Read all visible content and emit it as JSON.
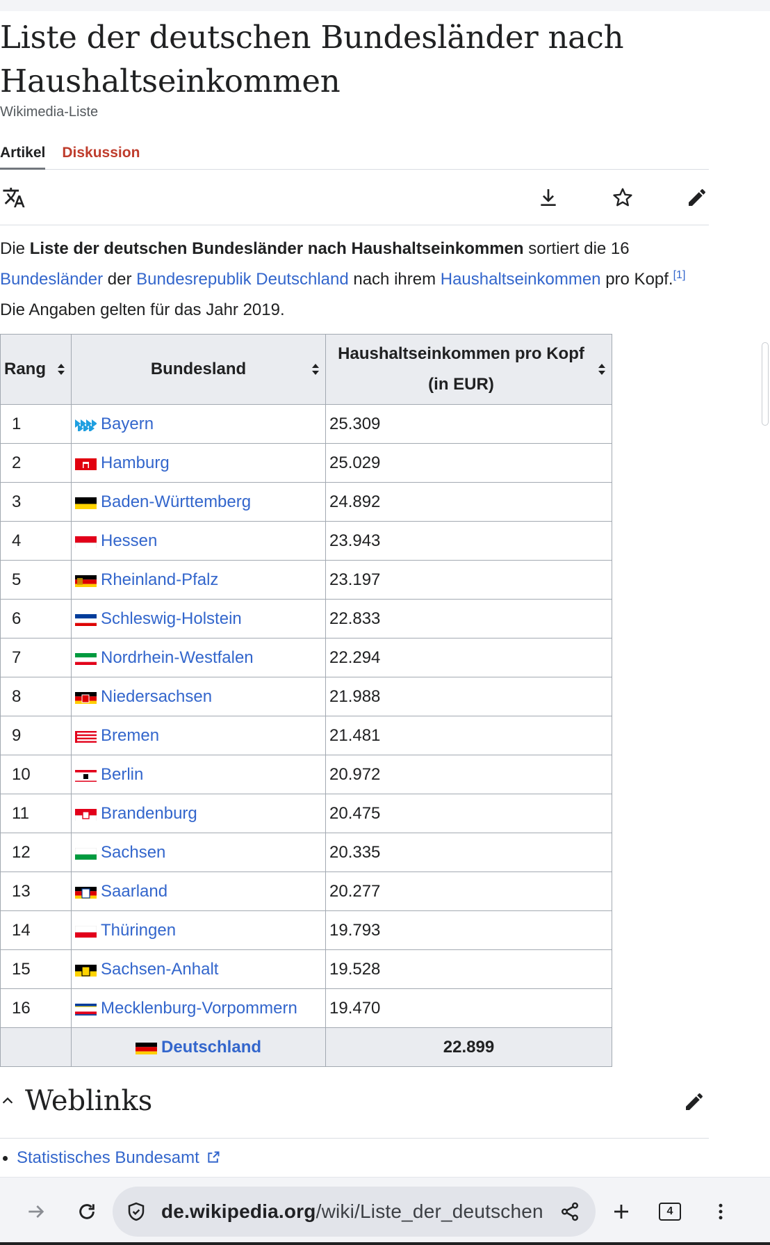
{
  "page": {
    "title": "Liste der deutschen Bundesländer nach Haushaltseinkommen",
    "subtitle": "Wikimedia-Liste"
  },
  "tabs": [
    {
      "label": "Artikel"
    },
    {
      "label": "Diskussion"
    }
  ],
  "toolbar": {
    "icons": [
      "translate-icon",
      "download-icon",
      "star-icon",
      "edit-pencil-icon"
    ]
  },
  "intro": {
    "t1": "Die ",
    "bold": "Liste der deutschen Bundesländer nach Haushaltseinkommen",
    "t2": " sortiert die 16 ",
    "link1": "Bundesländer",
    "t3": " der ",
    "link2": "Bundesrepublik Deutschland",
    "t4": " nach ihrem ",
    "link3": "Haushaltseinkommen",
    "t5": " pro Kopf.",
    "ref": "[1]",
    "t6": " Die Angaben gelten für das Jahr 2019."
  },
  "table": {
    "headers": {
      "rank": "Rang",
      "state": "Bundesland",
      "income_line1": "Haushaltseinkommen pro Kopf",
      "income_line2": "(in EUR)"
    },
    "rows": [
      {
        "rank": "1",
        "state": "Bayern",
        "value": "25.309"
      },
      {
        "rank": "2",
        "state": "Hamburg",
        "value": "25.029"
      },
      {
        "rank": "3",
        "state": "Baden-Württemberg",
        "value": "24.892"
      },
      {
        "rank": "4",
        "state": "Hessen",
        "value": "23.943"
      },
      {
        "rank": "5",
        "state": "Rheinland-Pfalz",
        "value": "23.197"
      },
      {
        "rank": "6",
        "state": "Schleswig-Holstein",
        "value": "22.833"
      },
      {
        "rank": "7",
        "state": "Nordrhein-Westfalen",
        "value": "22.294"
      },
      {
        "rank": "8",
        "state": "Niedersachsen",
        "value": "21.988"
      },
      {
        "rank": "9",
        "state": "Bremen",
        "value": "21.481"
      },
      {
        "rank": "10",
        "state": "Berlin",
        "value": "20.972"
      },
      {
        "rank": "11",
        "state": "Brandenburg",
        "value": "20.475"
      },
      {
        "rank": "12",
        "state": "Sachsen",
        "value": "20.335"
      },
      {
        "rank": "13",
        "state": "Saarland",
        "value": "20.277"
      },
      {
        "rank": "14",
        "state": "Thüringen",
        "value": "19.793"
      },
      {
        "rank": "15",
        "state": "Sachsen-Anhalt",
        "value": "19.528"
      },
      {
        "rank": "16",
        "state": "Mecklenburg-Vorpommern",
        "value": "19.470"
      }
    ],
    "total": {
      "state": "Deutschland",
      "value": "22.899"
    }
  },
  "section": {
    "title": "Weblinks",
    "links": [
      "Statistisches Bundesamt"
    ]
  },
  "browser": {
    "url_domain": "de.wikipedia.org",
    "url_path": "/wiki/Liste_der_deutschen_Bundesländer_nach_Haushaltseinkommen",
    "tab_count": "4"
  },
  "colors": {
    "link": "#3366cc",
    "discussion_tab": "#bf3c2c",
    "table_header_bg": "#eaecf0",
    "border": "#a2a9b1"
  }
}
